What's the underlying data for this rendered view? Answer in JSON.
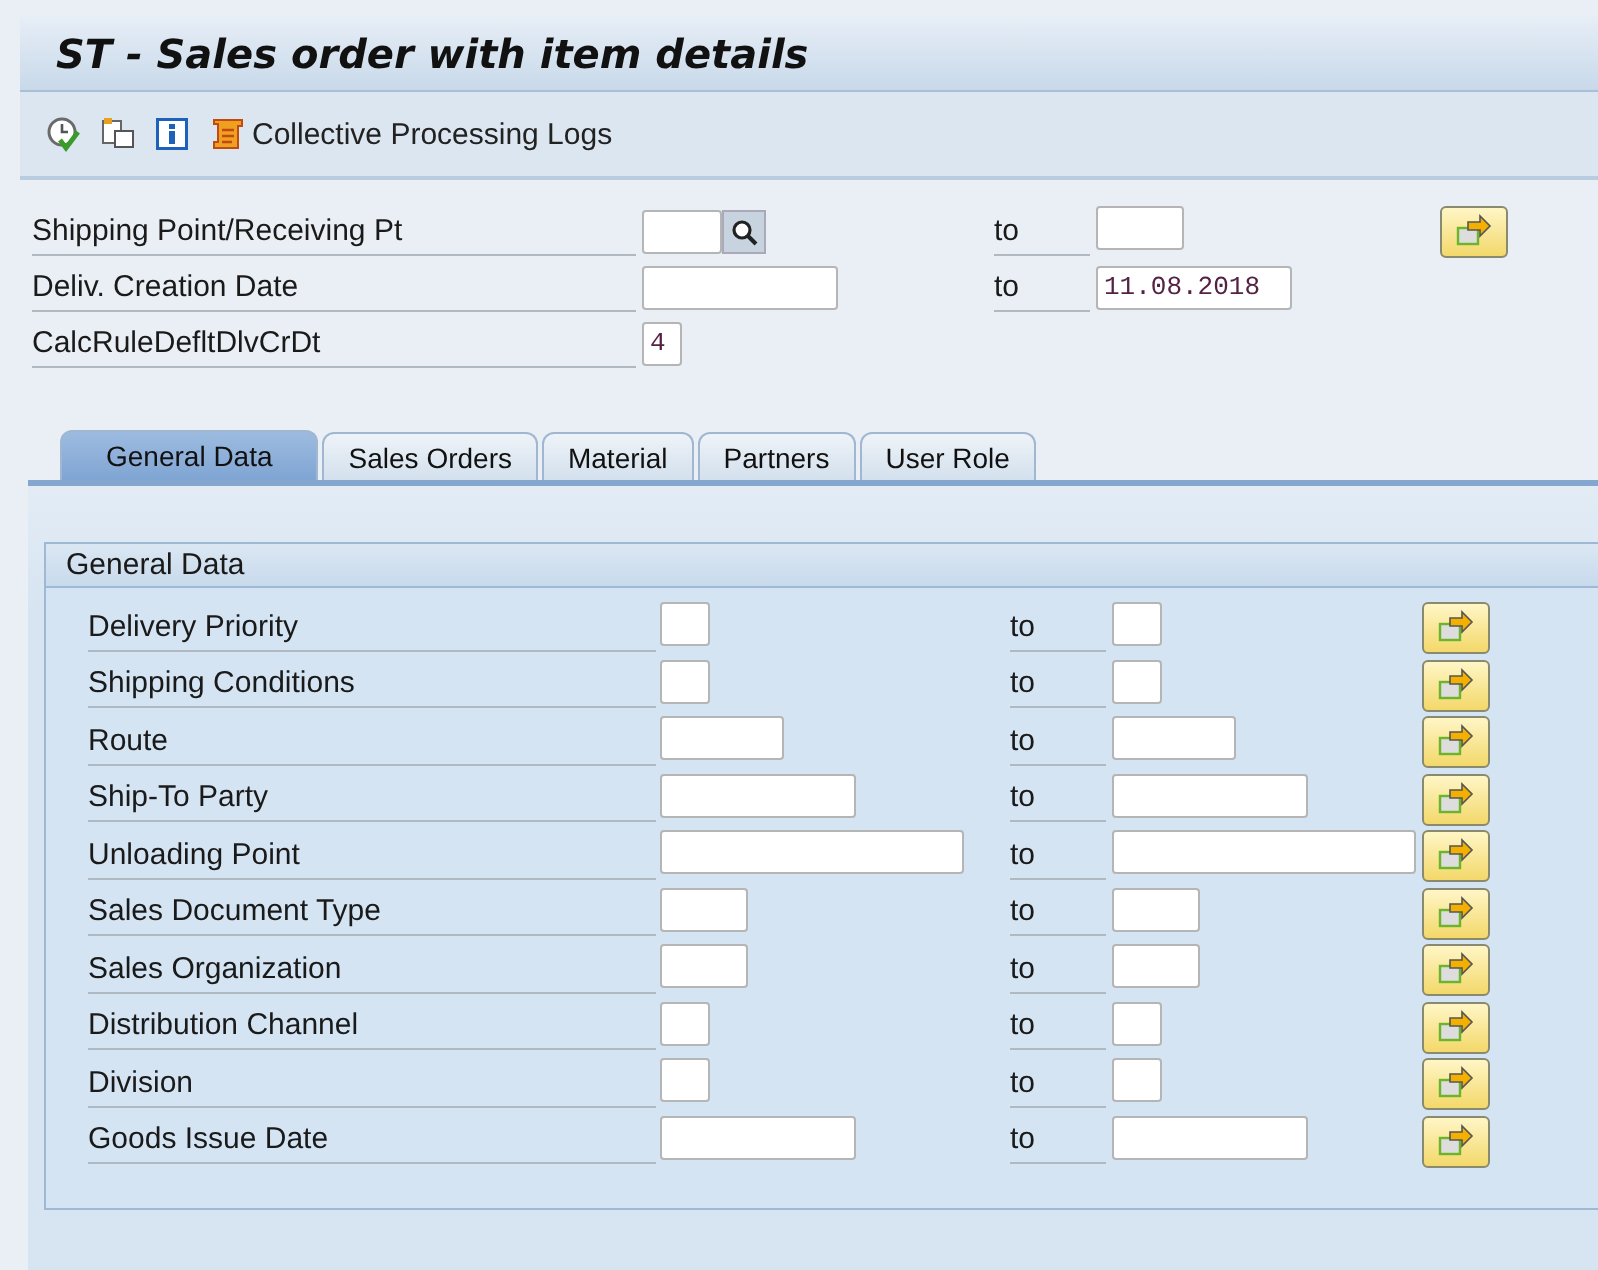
{
  "window": {
    "title": "ST - Sales order with item details"
  },
  "toolbar": {
    "icons": [
      {
        "kind": "execute"
      },
      {
        "kind": "variant"
      },
      {
        "kind": "info"
      }
    ],
    "logs_button": "Collective Processing Logs"
  },
  "header_fields": [
    {
      "kind": "range",
      "label": "Shipping Point/Receiving Pt",
      "search_help": true,
      "to_label": "to",
      "multiple_selection": true
    },
    {
      "kind": "range",
      "label": "Deliv. Creation Date",
      "search_help": false,
      "to_label": "to",
      "high_value": "11.08.2018",
      "multiple_selection": false
    },
    {
      "kind": "single",
      "label": "CalcRuleDefltDlvCrDt",
      "low_value": "4"
    }
  ],
  "tabs": [
    {
      "label": "General Data",
      "selected": true
    },
    {
      "label": "Sales Orders",
      "selected": false
    },
    {
      "label": "Material",
      "selected": false
    },
    {
      "label": "Partners",
      "selected": false
    },
    {
      "label": "User Role",
      "selected": false
    }
  ],
  "group": {
    "title": "General Data",
    "rows": [
      {
        "label": "Delivery Priority",
        "to_label": "to"
      },
      {
        "label": "Shipping Conditions",
        "to_label": "to"
      },
      {
        "label": "Route",
        "to_label": "to"
      },
      {
        "label": "Ship-To Party",
        "to_label": "to"
      },
      {
        "label": "Unloading Point",
        "to_label": "to"
      },
      {
        "label": "Sales Document Type",
        "to_label": "to"
      },
      {
        "label": "Sales Organization",
        "to_label": "to"
      },
      {
        "label": "Distribution Channel",
        "to_label": "to"
      },
      {
        "label": "Division",
        "to_label": "to"
      },
      {
        "label": "Goods Issue Date",
        "to_label": "to"
      }
    ]
  }
}
